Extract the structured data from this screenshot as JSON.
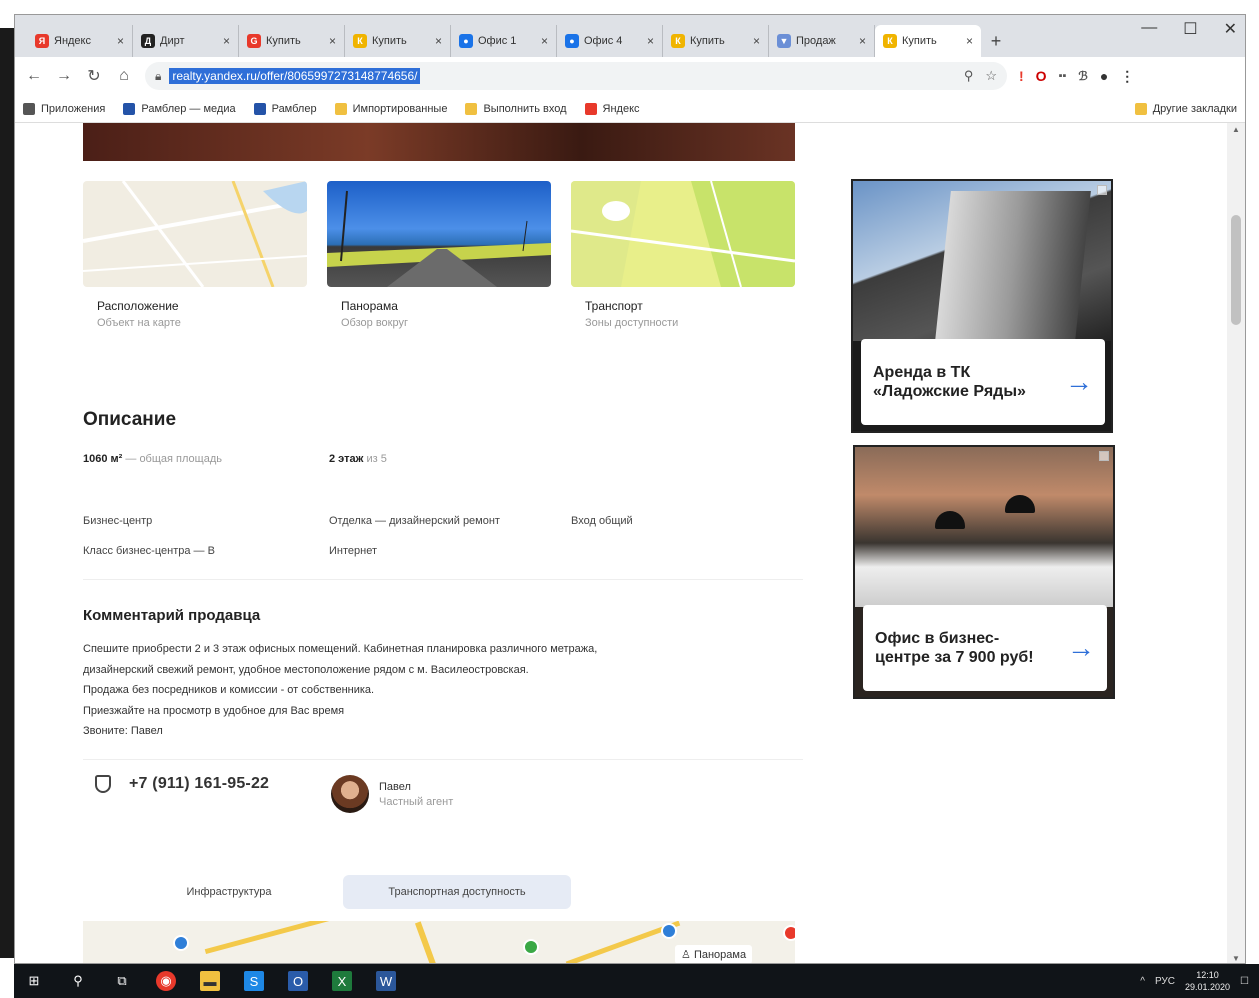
{
  "browser": {
    "tabs": [
      {
        "label": "Яндекс",
        "fav_color": "#e8392b",
        "fav_text": "Я",
        "active": false
      },
      {
        "label": "Дирт",
        "fav_color": "#222",
        "fav_text": "Д",
        "active": false
      },
      {
        "label": "Купить",
        "fav_color": "#e8392b",
        "fav_text": "G",
        "active": false
      },
      {
        "label": "Купить",
        "fav_color": "#f0b400",
        "fav_text": "К",
        "active": false
      },
      {
        "label": "Офис 1",
        "fav_color": "#1a73e8",
        "fav_text": "●",
        "active": false
      },
      {
        "label": "Офис 4",
        "fav_color": "#1a73e8",
        "fav_text": "●",
        "active": false
      },
      {
        "label": "Купить",
        "fav_color": "#f0b400",
        "fav_text": "К",
        "active": false
      },
      {
        "label": "Продаж",
        "fav_color": "#6b8fd6",
        "fav_text": "▼",
        "active": false
      },
      {
        "label": "Купить",
        "fav_color": "#f0b400",
        "fav_text": "К",
        "active": true
      }
    ],
    "url": "realty.yandex.ru/offer/8065997273148774656/",
    "bookmarks": [
      {
        "label": "Приложения",
        "color": "#555"
      },
      {
        "label": "Рамблер — медиа",
        "color": "#2453a8"
      },
      {
        "label": "Рамблер",
        "color": "#2453a8"
      },
      {
        "label": "Импортированные",
        "color": "#f0c040"
      },
      {
        "label": "Выполнить вход",
        "color": "#f0c040"
      },
      {
        "label": "Яндекс",
        "color": "#e8392b"
      }
    ],
    "bookmarks_right": "Другие закладки"
  },
  "media": [
    {
      "title": "Расположение",
      "subtitle": "Объект на карте"
    },
    {
      "title": "Панорама",
      "subtitle": "Обзор вокруг"
    },
    {
      "title": "Транспорт",
      "subtitle": "Зоны доступности"
    }
  ],
  "description": {
    "heading": "Описание",
    "area_value": "1060 м²",
    "area_label": " — общая площадь",
    "floor_value": "2 этаж",
    "floor_label": " из 5",
    "features": [
      "Бизнес-центр",
      "Отделка — дизайнерский ремонт",
      "Вход общий",
      "Класс бизнес-центра — B",
      "Интернет"
    ]
  },
  "comment": {
    "heading": "Комментарий продавца",
    "lines": [
      "Спешите приобрести 2 и 3 этаж офисных помещений. Кабинетная планировка различного метража,",
      "дизайнерский свежий ремонт, удобное местоположение рядом с м. Василеостровская.",
      "Продажа без посредников и комиссии - от собственника.",
      "Приезжайте на просмотр в удобное для Вас время",
      "Звоните: Павел"
    ]
  },
  "contact": {
    "phone": "+7 (911) 161-95-22",
    "agent_name": "Павел",
    "agent_role": "Частный агент"
  },
  "map_tabs": [
    {
      "label": "Инфраструктура",
      "selected": false
    },
    {
      "label": "Транспортная доступность",
      "selected": true
    }
  ],
  "map_button": "Панорама",
  "ads": [
    {
      "text": "Аренда в ТК «Ладожские Ряды»"
    },
    {
      "text": "Офис в бизнес-центре за 7 900 руб!"
    }
  ],
  "taskbar": {
    "lang": "РУС",
    "time": "12:10",
    "date": "29.01.2020"
  }
}
